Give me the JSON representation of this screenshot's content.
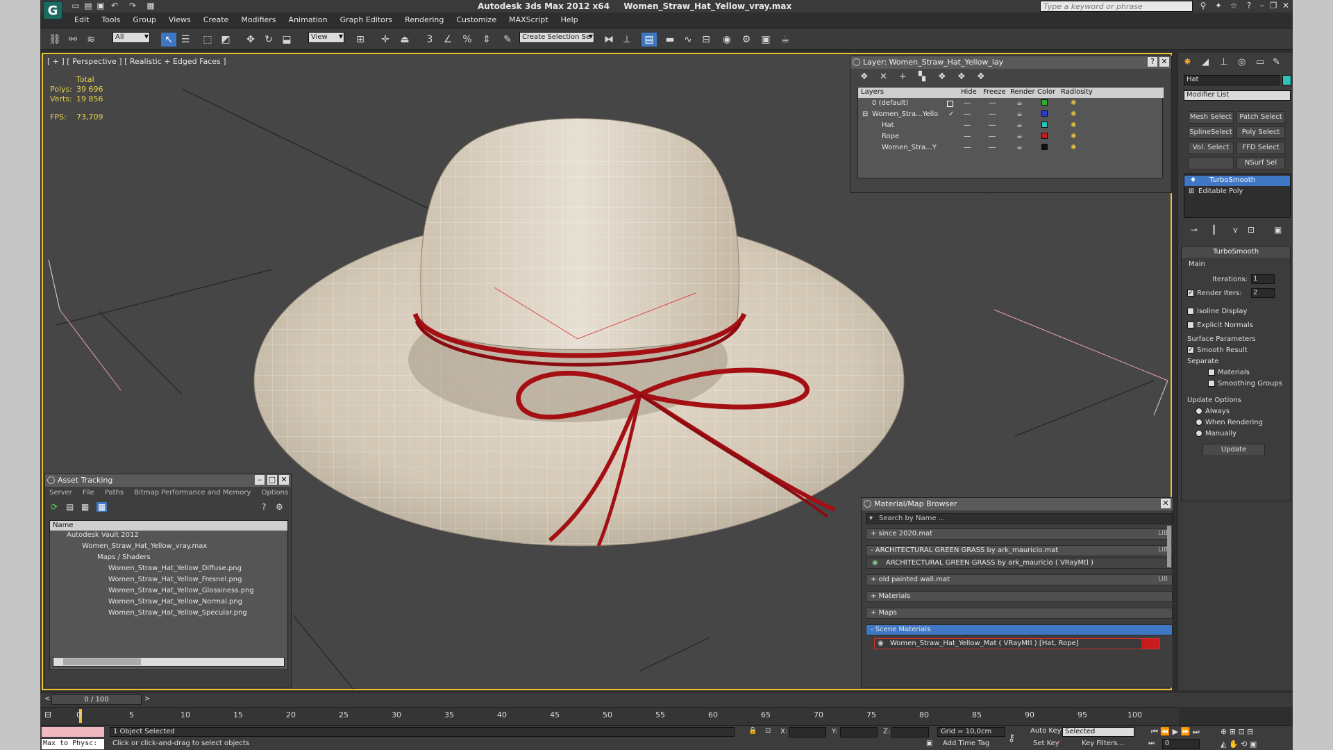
{
  "app": {
    "name": "Autodesk 3ds Max  2012 x64",
    "file": "Women_Straw_Hat_Yellow_vray.max",
    "search_placeholder": "Type a keyword or phrase",
    "logo": "G"
  },
  "menu": [
    "Edit",
    "Tools",
    "Group",
    "Views",
    "Create",
    "Modifiers",
    "Animation",
    "Graph Editors",
    "Rendering",
    "Customize",
    "MAXScript",
    "Help"
  ],
  "toolbar": {
    "filter": "All",
    "ref_coord": "View",
    "selection_set": "Create Selection Se",
    "snap_3": "3",
    "snap_percent": "%"
  },
  "viewport": {
    "label": "[ + ] [ Perspective ] [ Realistic + Edged Faces ]",
    "stats": {
      "total_label": "Total",
      "polys_label": "Polys:",
      "polys": "39 696",
      "verts_label": "Verts:",
      "verts": "19 856",
      "fps_label": "FPS:",
      "fps": "73,709"
    }
  },
  "layer_dialog": {
    "title": "Layer: Women_Straw_Hat_Yellow_lay",
    "columns": [
      "Layers",
      "Hide",
      "Freeze",
      "Render",
      "Color",
      "Radiosity"
    ],
    "rows": [
      {
        "name": "0 (default)",
        "color": "#2cb02c",
        "indent": 0
      },
      {
        "name": "Women_Stra...Yello",
        "color": "#2a38d8",
        "indent": 0
      },
      {
        "name": "Hat",
        "color": "#2ac4b8",
        "indent": 1
      },
      {
        "name": "Rope",
        "color": "#c81c1c",
        "indent": 1
      },
      {
        "name": "Women_Stra...Y",
        "color": "#101010",
        "indent": 1
      }
    ],
    "help": "?"
  },
  "command_panel": {
    "object_name": "Hat",
    "object_color": "#2ec4b6",
    "modifier_list": "Modifier List",
    "buttons": [
      "Mesh Select",
      "Patch Select",
      "SplineSelect",
      "Poly Select",
      "Vol. Select",
      "FFD Select",
      "",
      "NSurf Sel"
    ],
    "stack": [
      "TurboSmooth",
      "Editable Poly"
    ],
    "rollout_title": "TurboSmooth",
    "main_label": "Main",
    "iterations_label": "Iterations:",
    "iterations": "1",
    "render_iters_label": "Render Iters:",
    "render_iters": "2",
    "isoline": "Isoline Display",
    "explicit_normals": "Explicit Normals",
    "surface_params": "Surface Parameters",
    "smooth_result": "Smooth Result",
    "separate": "Separate",
    "materials": "Materials",
    "smoothing_groups": "Smoothing Groups",
    "update_options": "Update Options",
    "always": "Always",
    "when_rendering": "When Rendering",
    "manually": "Manually",
    "update": "Update"
  },
  "asset_tracking": {
    "title": "Asset Tracking",
    "menu": [
      "Server",
      "File",
      "Paths",
      "Bitmap Performance and Memory",
      "Options"
    ],
    "column": "Name",
    "rows": [
      {
        "text": "Autodesk Vault 2012",
        "indent": 1
      },
      {
        "text": "Women_Straw_Hat_Yellow_vray.max",
        "indent": 2
      },
      {
        "text": "Maps / Shaders",
        "indent": 3
      },
      {
        "text": "Women_Straw_Hat_Yellow_Diffuse.png",
        "indent": 4
      },
      {
        "text": "Women_Straw_Hat_Yellow_Fresnel.png",
        "indent": 4
      },
      {
        "text": "Women_Straw_Hat_Yellow_Glossiness.png",
        "indent": 4
      },
      {
        "text": "Women_Straw_Hat_Yellow_Normal.png",
        "indent": 4
      },
      {
        "text": "Women_Straw_Hat_Yellow_Specular.png",
        "indent": 4
      }
    ]
  },
  "material_browser": {
    "title": "Material/Map Browser",
    "search": "Search by Name ...",
    "rows": [
      {
        "text": "+ since 2020.mat",
        "lib": "LIB"
      },
      {
        "text": "- ARCHITECTURAL GREEN GRASS by ark_mauricio.mat",
        "lib": "LIB"
      },
      {
        "text": "ARCHITECTURAL GREEN GRASS by ark_mauricio  ( VRayMtl )",
        "lib": ""
      },
      {
        "text": "+ old painted wall.mat",
        "lib": "LIB"
      },
      {
        "text": "+ Materials",
        "lib": ""
      },
      {
        "text": "+ Maps",
        "lib": ""
      },
      {
        "text": "- Scene Materials",
        "lib": ""
      },
      {
        "text": "Women_Straw_Hat_Yellow_Mat  ( VRayMtl )  [Hat, Rope]",
        "lib": ""
      }
    ]
  },
  "timeline": {
    "frame": "0 / 100",
    "ticks": [
      "0",
      "5",
      "10",
      "15",
      "20",
      "25",
      "30",
      "35",
      "40",
      "45",
      "50",
      "55",
      "60",
      "65",
      "70",
      "75",
      "80",
      "85",
      "90",
      "95",
      "100"
    ]
  },
  "status": {
    "script_label": "Max to Physc:",
    "selected": "1 Object Selected",
    "prompt": "Click or click-and-drag to select objects",
    "x_label": "X:",
    "y_label": "Y:",
    "z_label": "Z:",
    "grid": "Grid = 10,0cm",
    "add_time_tag": "Add Time Tag",
    "auto_key": "Auto Key",
    "set_key": "Set Key",
    "key_mode": "Selected",
    "key_filters": "Key Filters...",
    "frame_field": "0"
  },
  "colors": {
    "accent": "#3f77c5",
    "viewport_border": "#f0c22a",
    "rope": "#a40f14"
  }
}
